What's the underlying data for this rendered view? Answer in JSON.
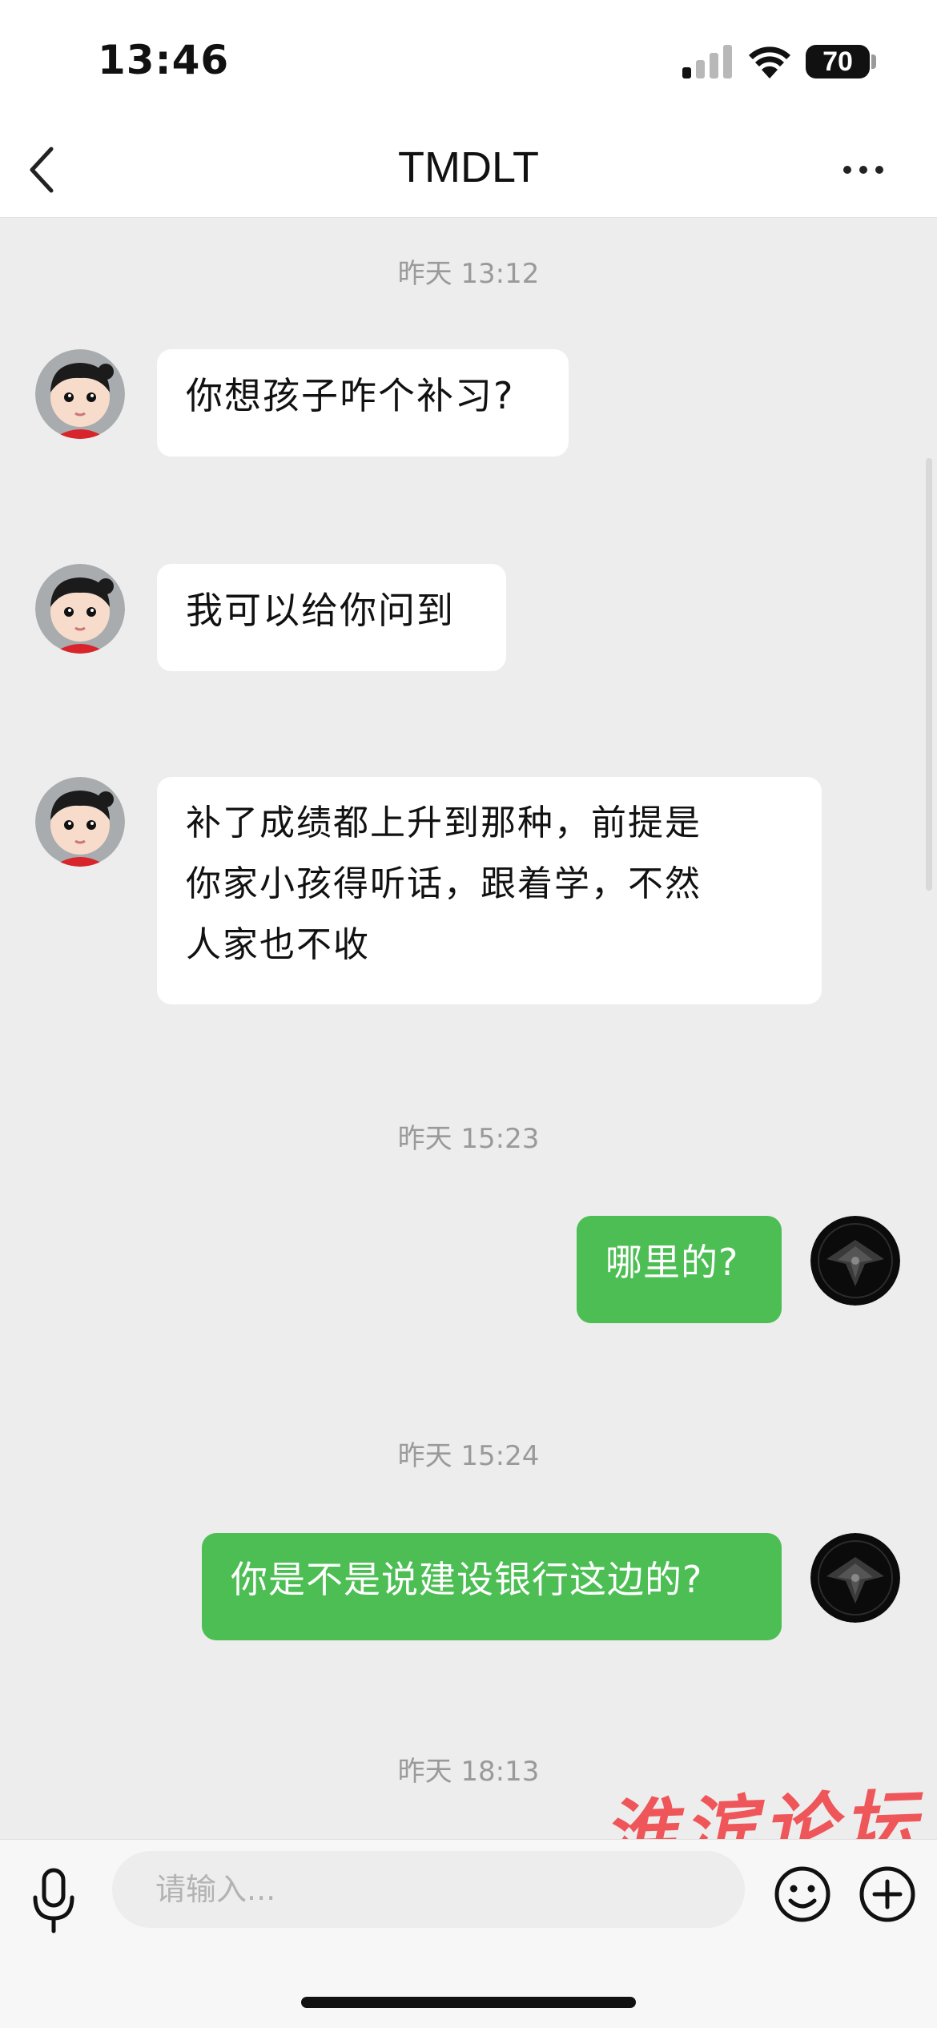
{
  "status_bar": {
    "time": "13:46",
    "battery_level": "70"
  },
  "header": {
    "title": "TMDLT",
    "back_icon": "chevron-left-icon",
    "more_icon": "more-dots-icon"
  },
  "chat": {
    "timestamps": [
      "昨天 13:12",
      "昨天 15:23",
      "昨天 15:24",
      "昨天 18:13"
    ],
    "messages": [
      {
        "from": "contact",
        "text": "你想孩子咋个补习?"
      },
      {
        "from": "contact",
        "text": "我可以给你问到"
      },
      {
        "from": "contact",
        "text": "补了成绩都上升到那种，前提是\n你家小孩得听话，跟着学，不然\n人家也不收"
      },
      {
        "from": "me",
        "text": "哪里的?"
      },
      {
        "from": "me",
        "text": "你是不是说建设银行这边的?"
      }
    ],
    "watermark": "淮滨论坛"
  },
  "input_bar": {
    "placeholder": "请输入...",
    "icons": [
      "microphone-icon",
      "emoji-icon",
      "plus-icon"
    ]
  },
  "colors": {
    "outgoing_bubble": "#4cbe54",
    "incoming_bubble": "#ffffff",
    "chat_background": "#ededed",
    "watermark": "#ef4a4e"
  }
}
